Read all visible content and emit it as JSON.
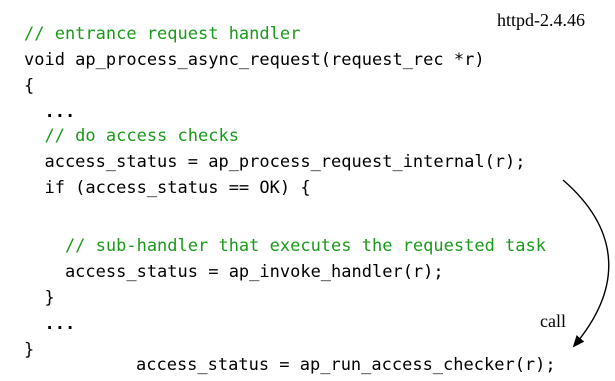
{
  "version_label": "httpd-2.4.46",
  "call_label": "call",
  "code_lines": [
    {
      "text": "// entrance request handler",
      "kind": "comment"
    },
    {
      "text": "void ap_process_async_request(request_rec *r)",
      "kind": "code"
    },
    {
      "text": "{",
      "kind": "code"
    },
    {
      "text": "  ...",
      "kind": "ellipsis"
    },
    {
      "text": "  // do access checks",
      "kind": "comment"
    },
    {
      "text": "  access_status = ap_process_request_internal(r);",
      "kind": "code"
    },
    {
      "text": "  if (access_status == OK) {",
      "kind": "code"
    },
    {
      "text": "",
      "kind": "code"
    },
    {
      "text": "    // sub-handler that executes the requested task",
      "kind": "comment"
    },
    {
      "text": "    access_status = ap_invoke_handler(r);",
      "kind": "code"
    },
    {
      "text": "  }",
      "kind": "code"
    },
    {
      "text": "  ...",
      "kind": "ellipsis"
    },
    {
      "text": "}",
      "kind": "code"
    }
  ],
  "callee_line": "access_status = ap_run_access_checker(r);",
  "colors": {
    "comment": "#1a9a1a",
    "code": "#000000"
  }
}
